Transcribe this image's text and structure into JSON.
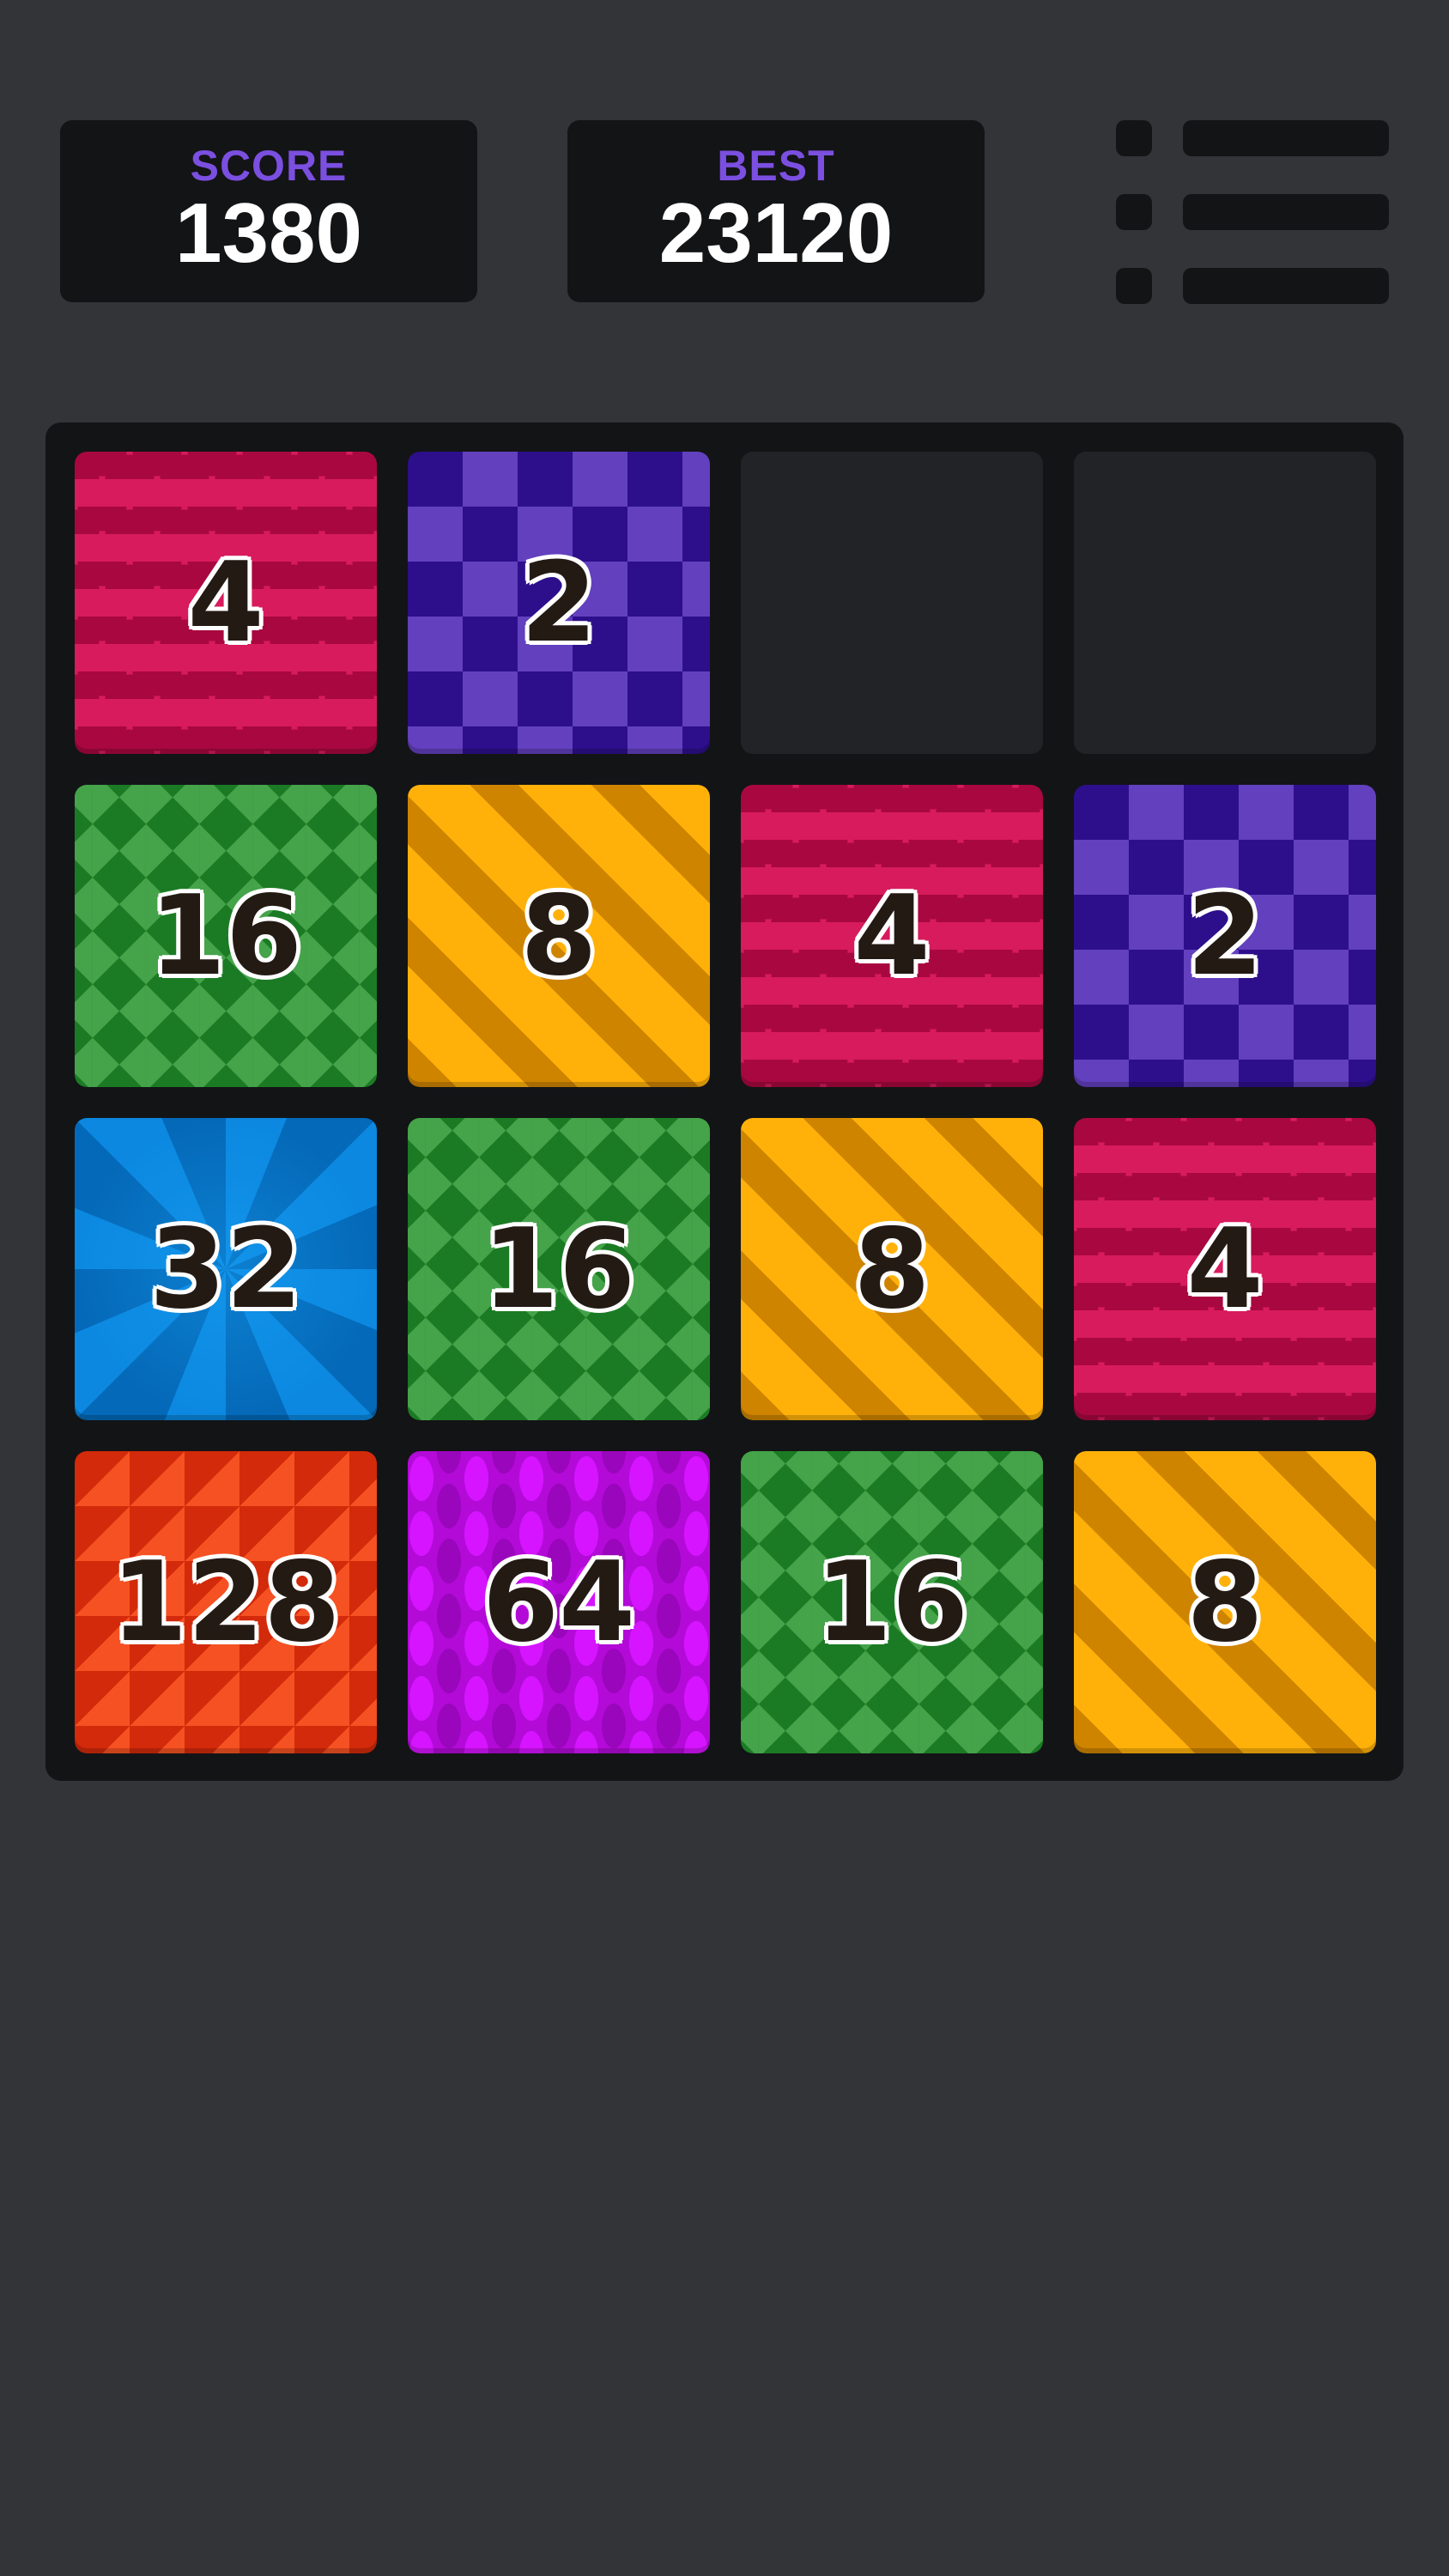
{
  "score": {
    "label": "SCORE",
    "value": "1380"
  },
  "best": {
    "label": "BEST",
    "value": "23120"
  },
  "menu": {
    "icon": "list-icon"
  },
  "board": {
    "rows": [
      [
        {
          "value": "4",
          "pattern": "waves",
          "color": "#d81b5c"
        },
        {
          "value": "2",
          "pattern": "checker",
          "color": "#2d0f8c"
        },
        {
          "value": "",
          "pattern": "empty",
          "color": "#222326"
        },
        {
          "value": "",
          "pattern": "empty",
          "color": "#222326"
        }
      ],
      [
        {
          "value": "16",
          "pattern": "diamonds",
          "color": "#1b7b24"
        },
        {
          "value": "8",
          "pattern": "stripes",
          "color": "#ffb10a"
        },
        {
          "value": "4",
          "pattern": "waves",
          "color": "#d81b5c"
        },
        {
          "value": "2",
          "pattern": "checker",
          "color": "#2d0f8c"
        }
      ],
      [
        {
          "value": "32",
          "pattern": "swirl",
          "color": "#0c88e0"
        },
        {
          "value": "16",
          "pattern": "diamonds",
          "color": "#1b7b24"
        },
        {
          "value": "8",
          "pattern": "stripes",
          "color": "#ffb10a"
        },
        {
          "value": "4",
          "pattern": "waves",
          "color": "#d81b5c"
        }
      ],
      [
        {
          "value": "128",
          "pattern": "triangles",
          "color": "#f55122"
        },
        {
          "value": "64",
          "pattern": "chain",
          "color": "#b30ad8"
        },
        {
          "value": "16",
          "pattern": "diamonds",
          "color": "#1b7b24"
        },
        {
          "value": "8",
          "pattern": "stripes",
          "color": "#ffb10a"
        }
      ]
    ]
  },
  "colors": {
    "background": "#333438",
    "panel": "#131416",
    "label_accent": "#7b4fe0"
  }
}
